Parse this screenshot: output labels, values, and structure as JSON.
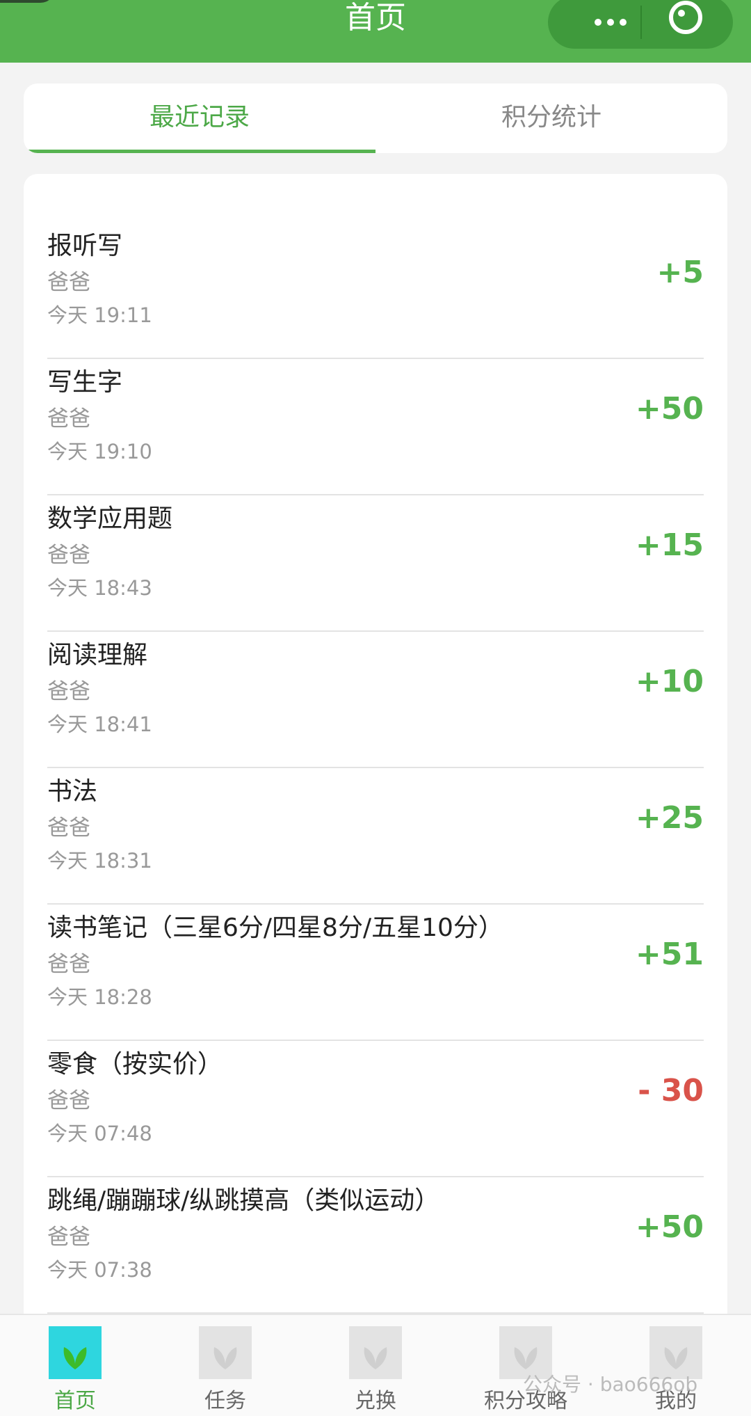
{
  "header": {
    "title": "首页"
  },
  "tabs": [
    {
      "label": "最近记录",
      "active": true
    },
    {
      "label": "积分统计",
      "active": false
    }
  ],
  "records": [
    {
      "name": "报听写",
      "who": "爸爸",
      "time": "今天 19:11",
      "points": "+5"
    },
    {
      "name": "写生字",
      "who": "爸爸",
      "time": "今天 19:10",
      "points": "+50"
    },
    {
      "name": "数学应用题",
      "who": "爸爸",
      "time": "今天 18:43",
      "points": "+15"
    },
    {
      "name": "阅读理解",
      "who": "爸爸",
      "time": "今天 18:41",
      "points": "+10"
    },
    {
      "name": "书法",
      "who": "爸爸",
      "time": "今天 18:31",
      "points": "+25"
    },
    {
      "name": "读书笔记（三星6分/四星8分/五星10分）",
      "who": "爸爸",
      "time": "今天 18:28",
      "points": "+51"
    },
    {
      "name": "零食（按实价）",
      "who": "爸爸",
      "time": "今天 07:48",
      "points": "- 30"
    },
    {
      "name": "跳绳/蹦蹦球/纵跳摸高（类似运动）",
      "who": "爸爸",
      "time": "今天 07:38",
      "points": "+50"
    }
  ],
  "tabbar": [
    {
      "label": "首页",
      "icon": "leaf-icon"
    },
    {
      "label": "任务",
      "icon": "leaf-icon"
    },
    {
      "label": "兑换",
      "icon": "leaf-icon"
    },
    {
      "label": "积分攻略",
      "icon": "leaf-icon"
    },
    {
      "label": "我的",
      "icon": "leaf-icon"
    }
  ],
  "watermark": "公众号 · bao666ob",
  "colors": {
    "primary": "#56b350",
    "negative": "#d9534a",
    "active_icon_bg": "#2ed6df"
  }
}
